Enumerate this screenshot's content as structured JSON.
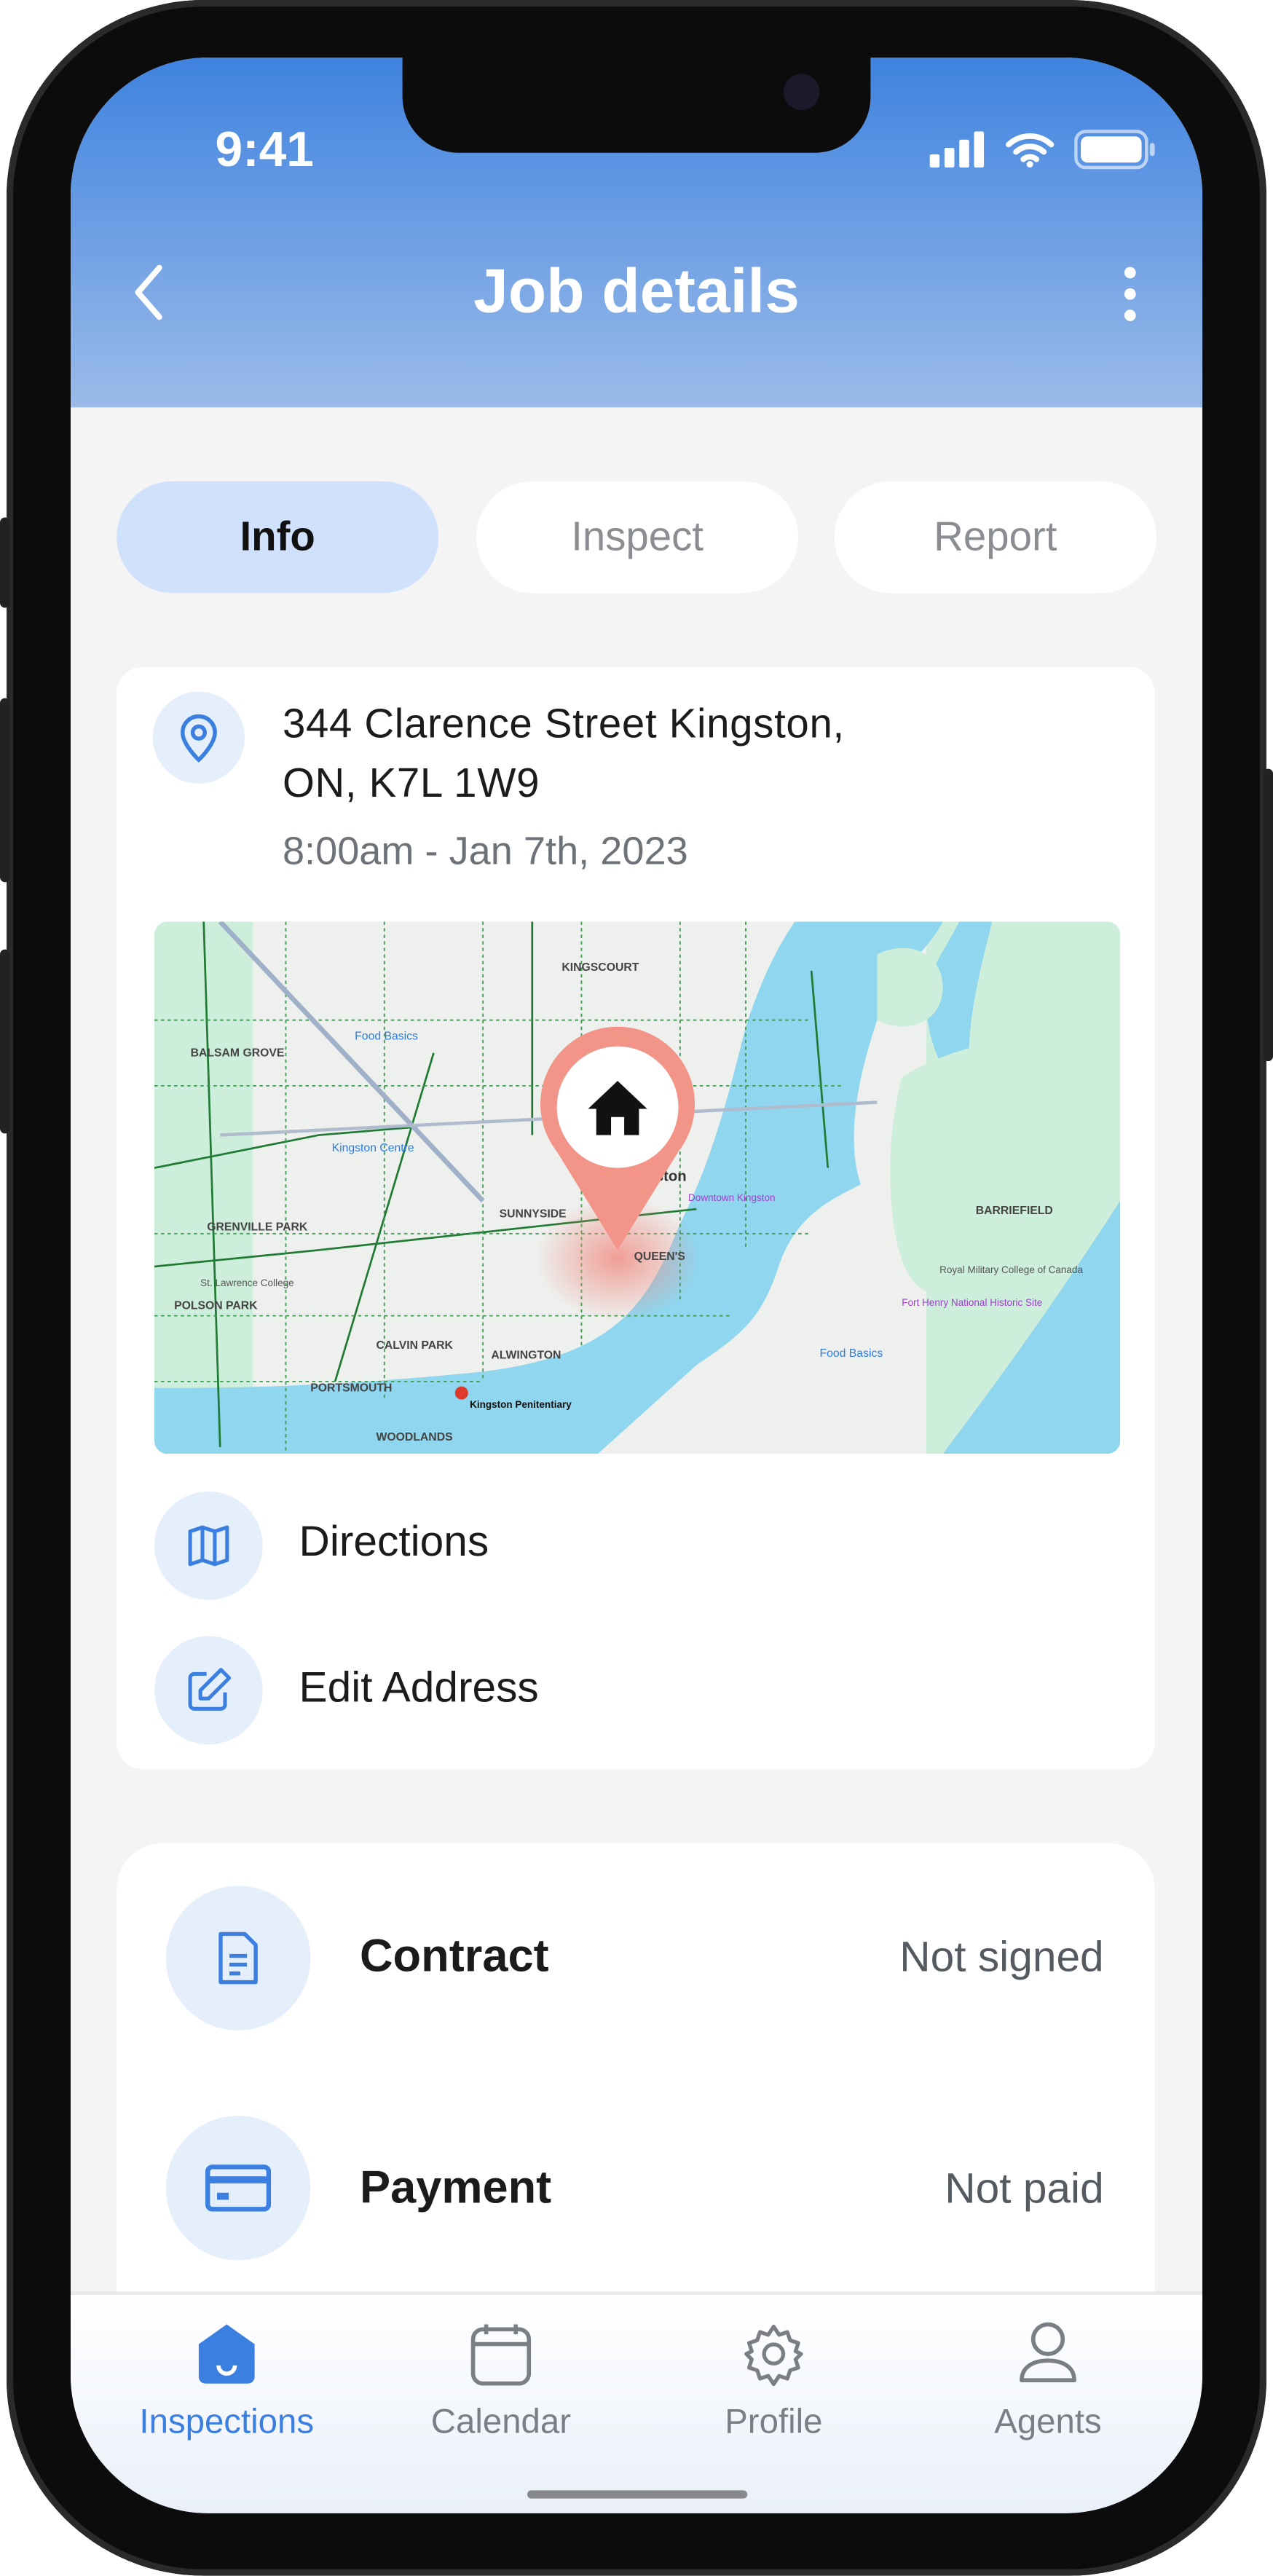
{
  "status_bar": {
    "time": "9:41"
  },
  "header": {
    "title": "Job details",
    "back_icon": "chevron-left-icon",
    "more_icon": "more-vertical-icon"
  },
  "tabs": [
    {
      "label": "Info",
      "active": true
    },
    {
      "label": "Inspect",
      "active": false
    },
    {
      "label": "Report",
      "active": false
    }
  ],
  "location": {
    "address_line1": "344 Clarence Street Kingston,",
    "address_line2": "ON, K7L 1W9",
    "datetime": "8:00am - Jan 7th, 2023",
    "map_labels": {
      "kingston": "Kingston",
      "kingscourt": "KINGSCOURT",
      "balsam": "BALSAM GROVE",
      "grenville": "GRENVILLE PARK",
      "polson": "POLSON PARK",
      "calvin": "CALVIN PARK",
      "woodlands": "WOODLANDS",
      "sunnyside": "SUNNYSIDE",
      "queens": "QUEEN'S",
      "alwington": "ALWINGTON",
      "portsmouth": "PORTSMOUTH",
      "barriefield": "BARRIEFIELD",
      "food1": "Food Basics",
      "food2": "Food Basics",
      "centre": "Kingston Centre",
      "downtown": "Downtown Kingston",
      "rmc": "Royal Military College of Canada",
      "fort": "Fort Henry National Historic Site",
      "college": "St. Lawrence College",
      "pen": "Kingston Penitentiary"
    }
  },
  "actions": [
    {
      "label": "Directions",
      "icon": "map-icon"
    },
    {
      "label": "Edit Address",
      "icon": "edit-icon"
    }
  ],
  "documents": [
    {
      "label": "Contract",
      "value": "Not signed",
      "icon": "document-icon"
    },
    {
      "label": "Payment",
      "value": "Not paid",
      "icon": "credit-card-icon"
    }
  ],
  "nav": [
    {
      "label": "Inspections",
      "active": true
    },
    {
      "label": "Calendar"
    },
    {
      "label": "Profile"
    },
    {
      "label": "Agents"
    }
  ],
  "colors": {
    "accent": "#3b7fe0",
    "header_top": "#3f83df",
    "tab_active": "#cfe1fb",
    "pin": "#f08a80"
  }
}
